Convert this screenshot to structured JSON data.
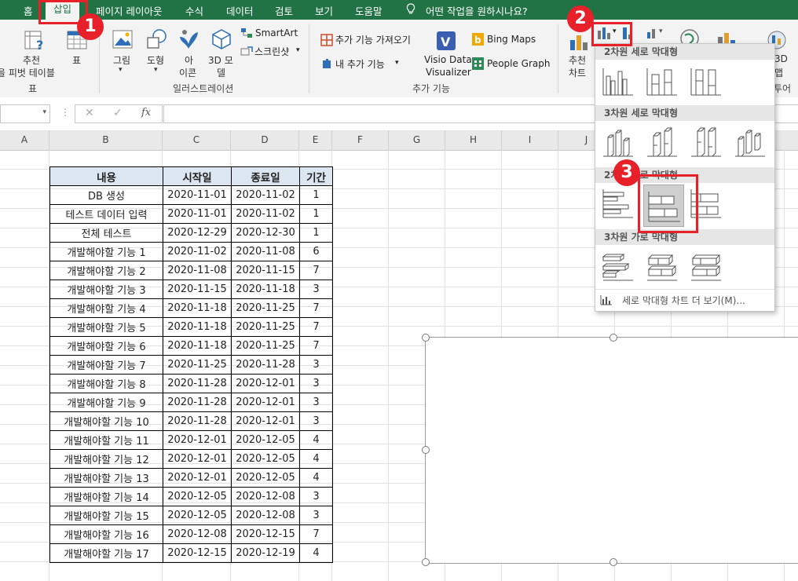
{
  "ribbon_tabs": [
    "홈",
    "삽입",
    "페이지 레이아웃",
    "수식",
    "데이터",
    "검토",
    "보기",
    "도움말"
  ],
  "tell_me": "어떤 작업을 원하시나요?",
  "ribbon": {
    "recommended_pivot_1": "추천",
    "recommended_pivot_2": "을 피벗 테이블",
    "table": "표",
    "group_table": "표",
    "picture": "그림",
    "shapes": "도형",
    "icons_1": "아",
    "icons_2": "이콘",
    "models_1": "3D 모",
    "models_2": "델",
    "smartart": "SmartArt",
    "screenshot": "스크린샷",
    "group_illustrations": "일러스트레이션",
    "get_addins": "추가 기능 가져오기",
    "my_addins": "내 추가 기능",
    "visio_1": "Visio Data",
    "visio_2": "Visualizer",
    "bing_maps": "Bing Maps",
    "people_graph": "People Graph",
    "group_addins": "추가 기능",
    "rec_charts_1": "추천",
    "rec_charts_2": "차트",
    "map3d_1": "3D",
    "map3d_2": "맵",
    "tour": "투어"
  },
  "formula_bar": {
    "cancel": "✕",
    "enter": "✓",
    "fx": "fx"
  },
  "columns": [
    "A",
    "B",
    "C",
    "D",
    "E",
    "F",
    "G",
    "H",
    "I",
    "J"
  ],
  "table": {
    "headers": [
      "내용",
      "시작일",
      "종료일",
      "기간"
    ],
    "rows": [
      [
        "DB 생성",
        "2020-11-01",
        "2020-11-02",
        "1"
      ],
      [
        "테스트 데이터 입력",
        "2020-11-01",
        "2020-11-02",
        "1"
      ],
      [
        "전체 테스트",
        "2020-12-29",
        "2020-12-30",
        "1"
      ],
      [
        "개발해야할 기능 1",
        "2020-11-02",
        "2020-11-08",
        "6"
      ],
      [
        "개발해야할 기능 2",
        "2020-11-08",
        "2020-11-15",
        "7"
      ],
      [
        "개발해야할 기능 3",
        "2020-11-15",
        "2020-11-18",
        "3"
      ],
      [
        "개발해야할 기능 4",
        "2020-11-18",
        "2020-11-25",
        "7"
      ],
      [
        "개발해야할 기능 5",
        "2020-11-18",
        "2020-11-25",
        "7"
      ],
      [
        "개발해야할 기능 6",
        "2020-11-18",
        "2020-11-25",
        "7"
      ],
      [
        "개발해야할 기능 7",
        "2020-11-25",
        "2020-11-28",
        "3"
      ],
      [
        "개발해야할 기능 8",
        "2020-11-28",
        "2020-12-01",
        "3"
      ],
      [
        "개발해야할 기능 9",
        "2020-11-28",
        "2020-12-01",
        "3"
      ],
      [
        "개발해야할 기능 10",
        "2020-11-28",
        "2020-12-01",
        "3"
      ],
      [
        "개발해야할 기능 11",
        "2020-12-01",
        "2020-12-05",
        "4"
      ],
      [
        "개발해야할 기능 12",
        "2020-12-01",
        "2020-12-05",
        "4"
      ],
      [
        "개발해야할 기능 13",
        "2020-12-01",
        "2020-12-05",
        "4"
      ],
      [
        "개발해야할 기능 14",
        "2020-12-05",
        "2020-12-08",
        "3"
      ],
      [
        "개발해야할 기능 15",
        "2020-12-05",
        "2020-12-08",
        "3"
      ],
      [
        "개발해야할 기능 16",
        "2020-12-08",
        "2020-12-15",
        "7"
      ],
      [
        "개발해야할 기능 17",
        "2020-12-15",
        "2020-12-19",
        "4"
      ]
    ]
  },
  "dropdown": {
    "section_2d_col": "2차원 세로 막대형",
    "section_3d_col": "3차원 세로 막대형",
    "section_2d_bar": "2차원 가로 막대형",
    "section_3d_bar": "3차원 가로 막대형",
    "more_charts": "세로 막대형 차트 더 보기(M)..."
  },
  "annotations": [
    "1",
    "2",
    "3"
  ],
  "colors": {
    "excel_green": "#217346",
    "annotation_red": "#e8202a",
    "header_fill": "#dce6f1"
  }
}
